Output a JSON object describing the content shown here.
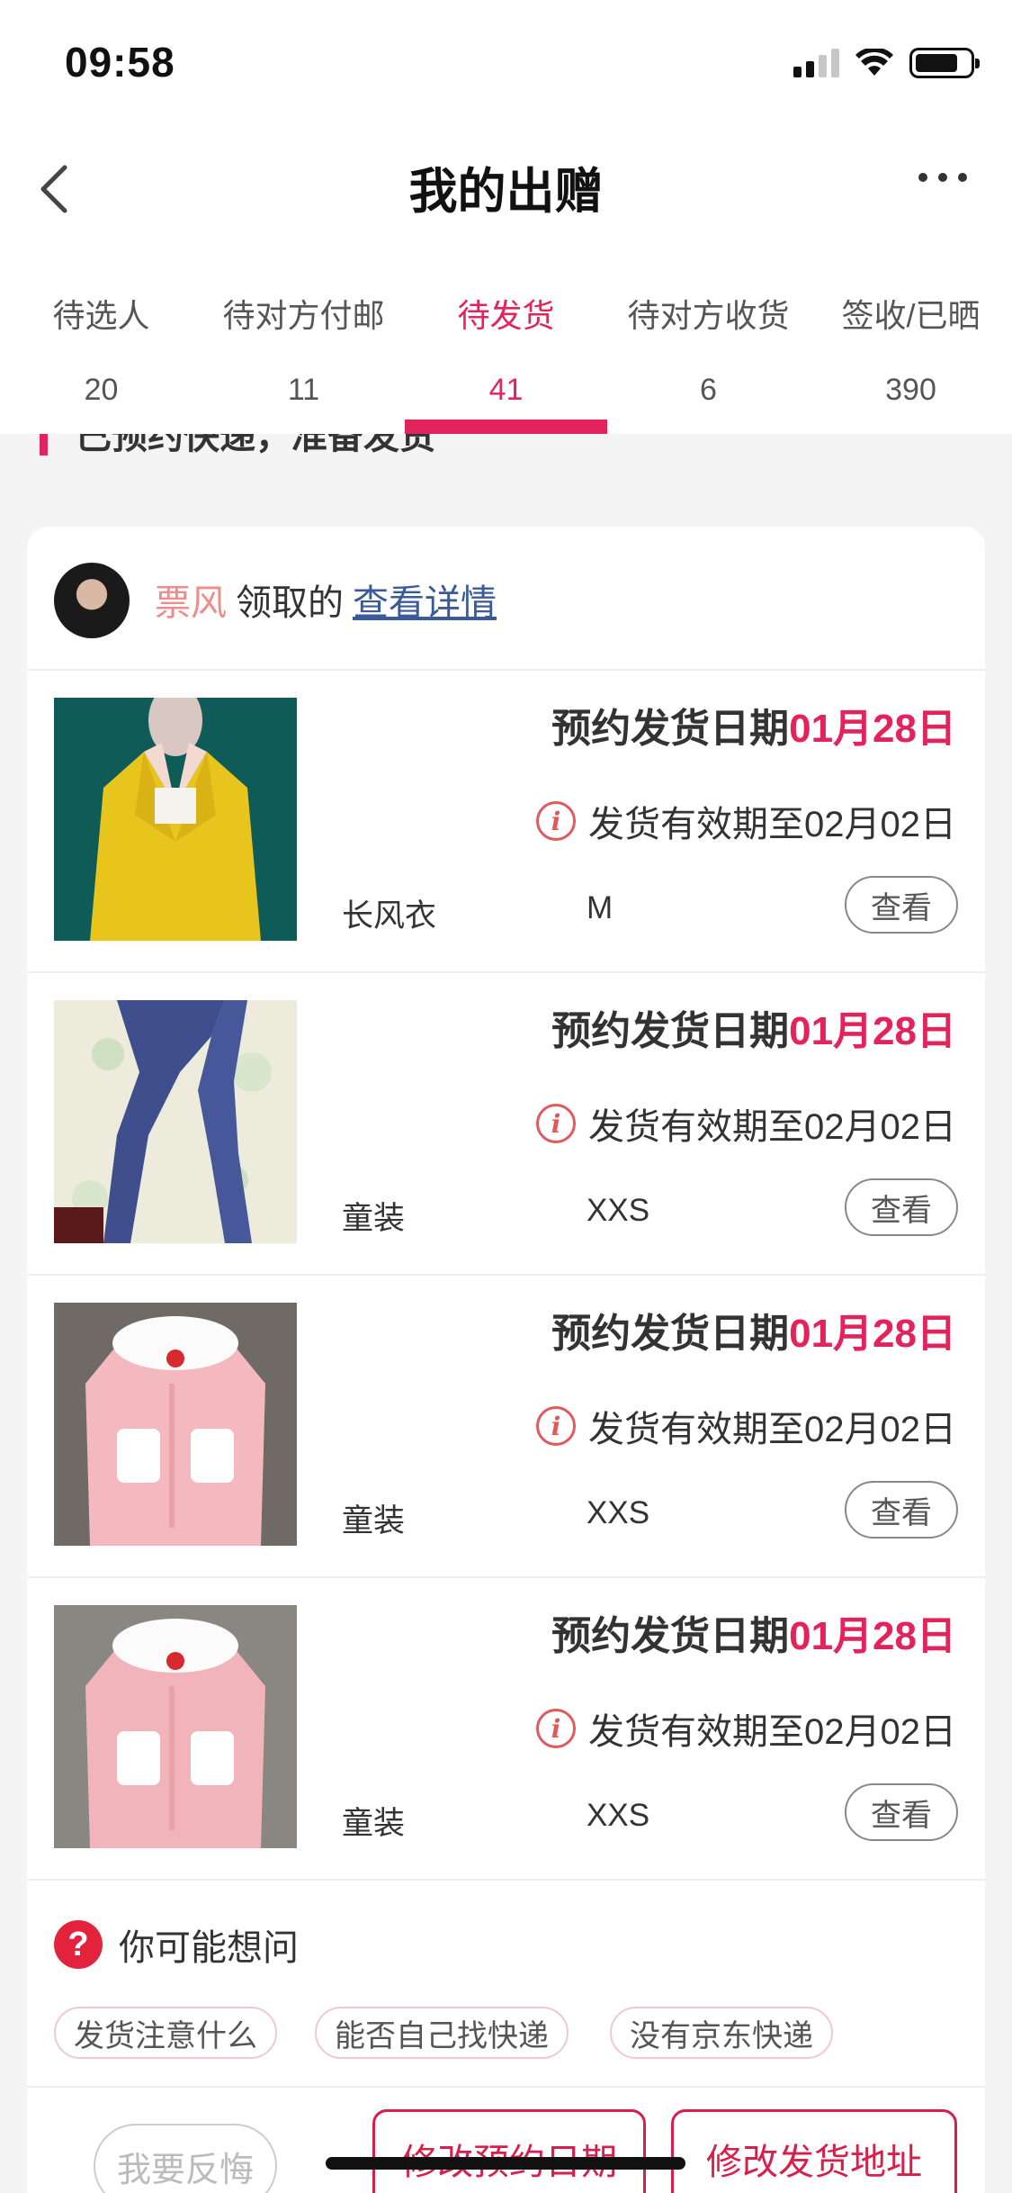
{
  "status_bar": {
    "time": "09:58"
  },
  "nav": {
    "title": "我的出赠"
  },
  "tabs": [
    {
      "label": "待选人",
      "count": "20",
      "active": false
    },
    {
      "label": "待对方付邮",
      "count": "11",
      "active": false
    },
    {
      "label": "待发货",
      "count": "41",
      "active": true
    },
    {
      "label": "待对方收货",
      "count": "6",
      "active": false
    },
    {
      "label": "签收/已晒",
      "count": "390",
      "active": false
    }
  ],
  "partial_header": "已预约快递，准备发货",
  "receiver": {
    "name": "票风",
    "text": "领取的",
    "link": "查看详情"
  },
  "items": [
    {
      "ship_label": "预约发货日期",
      "ship_date": "01月28日",
      "validity": "发货有效期至02月02日",
      "name": "长风衣",
      "size": "M",
      "view": "查看",
      "image": "yellow-coat"
    },
    {
      "ship_label": "预约发货日期",
      "ship_date": "01月28日",
      "validity": "发货有效期至02月02日",
      "name": "童装",
      "size": "XXS",
      "view": "查看",
      "image": "blue-tights"
    },
    {
      "ship_label": "预约发货日期",
      "ship_date": "01月28日",
      "validity": "发货有效期至02月02日",
      "name": "童装",
      "size": "XXS",
      "view": "查看",
      "image": "pink-pajamas"
    },
    {
      "ship_label": "预约发货日期",
      "ship_date": "01月28日",
      "validity": "发货有效期至02月02日",
      "name": "童装",
      "size": "XXS",
      "view": "查看",
      "image": "pink-pajamas"
    }
  ],
  "faq": {
    "title": "你可能想问",
    "chips": [
      "发货注意什么",
      "能否自己找快递",
      "没有京东快递"
    ]
  },
  "actions": {
    "regret": "我要反悔",
    "change_date": "修改预约日期",
    "change_address": "修改发货地址"
  },
  "colors": {
    "accent": "#e3235b",
    "link": "#3a5a98",
    "receiver_name": "#f08c8c"
  }
}
